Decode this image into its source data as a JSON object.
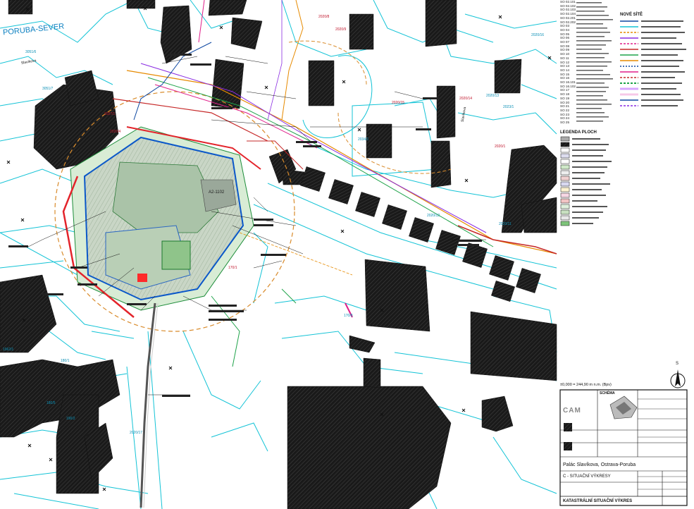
{
  "map": {
    "district_label": "PORUBA-SEVER",
    "street_labels": [
      "Slavíkova",
      "Slavíkova"
    ],
    "parcels": [
      "3051/6",
      "3051/7",
      "2020/8",
      "2020/9",
      "2020/4",
      "2020/11",
      "2020/12",
      "2020/13",
      "2020/14",
      "2020/15",
      "2020/16",
      "2020/17",
      "170/1",
      "170/8",
      "180/1",
      "180/5",
      "190/2",
      "1962/1",
      "2020/1",
      "2023/1",
      "2027/1",
      "2034/1"
    ],
    "building_label": "A2-1102"
  },
  "legend": {
    "new_networks_title": "NOVÉ SÍTĚ",
    "so_codes": [
      "SO 02.101",
      "SO 02.102",
      "SO 02.103",
      "SO 02.104",
      "SO 02.201",
      "SO 02.202",
      "SO 03",
      "SO 04",
      "SO 05",
      "SO 06",
      "SO 07",
      "SO 08",
      "SO 09",
      "SO 10",
      "SO 11",
      "SO 12",
      "SO 13",
      "SO 14",
      "SO 15",
      "SO 16",
      "SO 16.101",
      "SO 16.102",
      "SO 17",
      "SO 18",
      "SO 19",
      "SO 20",
      "SO 21",
      "SO 22",
      "SO 23",
      "SO 24",
      "SO 25"
    ],
    "areas_title": "LEGENDA PLOCH"
  },
  "title_block": {
    "scale_text": "±0,000 = 244,90 m n.m. (Bpv)",
    "schema_label": "SCHÉMA",
    "firm_logo": "CAM",
    "project_name": "Palác Slavíkova, Ostrava-Poruba",
    "section_name": "C - SITUAČNÍ VÝKRESY",
    "drawing_name": "KATASTRÁLNÍ SITUAČNÍ VÝKRES",
    "north_label": "S"
  }
}
